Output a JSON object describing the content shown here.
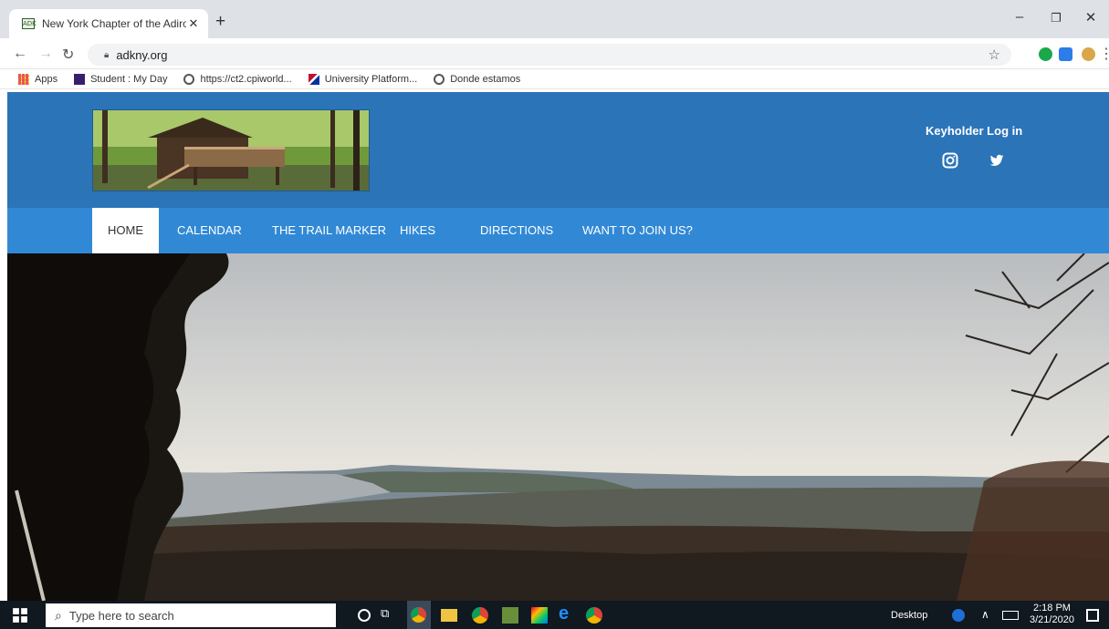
{
  "browser": {
    "tab_title": "New York Chapter of the Adirond",
    "favicon_text": "ADK",
    "url": "adkny.org",
    "bookmarks": [
      {
        "label": "Apps",
        "icon": "apps-grid-icon"
      },
      {
        "label": "Student : My Day",
        "icon": "student-app-icon"
      },
      {
        "label": "https://ct2.cpiworld...",
        "icon": "globe-icon"
      },
      {
        "label": "University Platform...",
        "icon": "flag-icon"
      },
      {
        "label": "Donde estamos",
        "icon": "globe-icon"
      }
    ]
  },
  "site": {
    "keyholder_label": "Keyholder Log in",
    "nav": [
      {
        "label": "HOME",
        "active": true
      },
      {
        "label": "CALENDAR",
        "active": false
      },
      {
        "label": "THE TRAIL MARKER",
        "active": false
      },
      {
        "label": "HIKES",
        "active": false
      },
      {
        "label": "DIRECTIONS",
        "active": false
      },
      {
        "label": "WANT TO JOIN US?",
        "active": false
      }
    ],
    "colors": {
      "header": "#2b74b8",
      "nav": "#3189d6"
    }
  },
  "taskbar": {
    "search_placeholder": "Type here to search",
    "desktop_label": "Desktop",
    "time": "2:18 PM",
    "date": "3/21/2020"
  }
}
